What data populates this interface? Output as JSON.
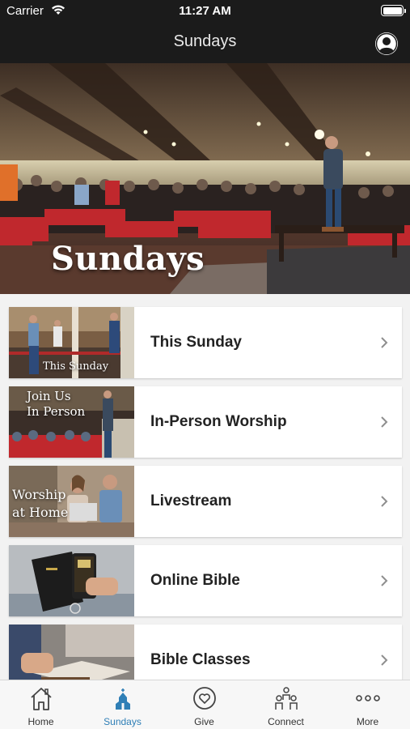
{
  "status_bar": {
    "carrier": "Carrier",
    "time": "11:27 AM"
  },
  "header": {
    "title": "Sundays"
  },
  "hero": {
    "caption": "Sundays"
  },
  "items": [
    {
      "label": "This Sunday",
      "thumb_caption": "This Sunday"
    },
    {
      "label": "In-Person Worship",
      "thumb_caption_1": "Join Us",
      "thumb_caption_2": "In Person"
    },
    {
      "label": "Livestream",
      "thumb_caption_1": "Worship",
      "thumb_caption_2": "at Home"
    },
    {
      "label": "Online Bible"
    },
    {
      "label": "Bible Classes"
    }
  ],
  "tabs": [
    {
      "label": "Home",
      "icon": "home-icon"
    },
    {
      "label": "Sundays",
      "icon": "church-icon",
      "active": true
    },
    {
      "label": "Give",
      "icon": "heart-icon"
    },
    {
      "label": "Connect",
      "icon": "people-icon"
    },
    {
      "label": "More",
      "icon": "more-icon"
    }
  ],
  "colors": {
    "nav_background": "#1b1b1b",
    "accent": "#2f7fb6",
    "pew_red": "#c0282d"
  }
}
